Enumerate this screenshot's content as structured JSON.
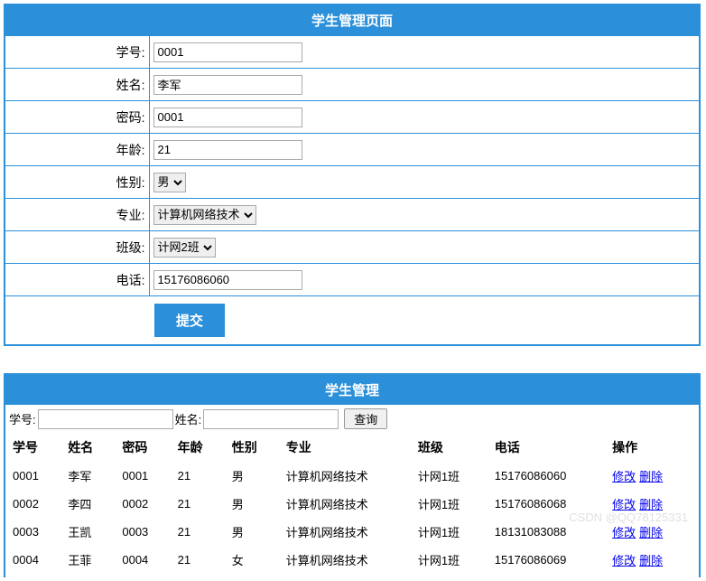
{
  "form": {
    "title": "学生管理页面",
    "fields": {
      "id_label": "学号:",
      "id_value": "0001",
      "name_label": "姓名:",
      "name_value": "李军",
      "password_label": "密码:",
      "password_value": "0001",
      "age_label": "年龄:",
      "age_value": "21",
      "gender_label": "性别:",
      "gender_value": "男",
      "major_label": "专业:",
      "major_value": "计算机网络技术",
      "class_label": "班级:",
      "class_value": "计网2班",
      "phone_label": "电话:",
      "phone_value": "15176086060"
    },
    "submit_label": "提交"
  },
  "list": {
    "title": "学生管理",
    "search": {
      "id_label": "学号:",
      "name_label": "姓名:",
      "button_label": "查询"
    },
    "columns": {
      "id": "学号",
      "name": "姓名",
      "password": "密码",
      "age": "年龄",
      "gender": "性别",
      "major": "专业",
      "class": "班级",
      "phone": "电话",
      "action": "操作"
    },
    "rows": [
      {
        "id": "0001",
        "name": "李军",
        "password": "0001",
        "age": "21",
        "gender": "男",
        "major": "计算机网络技术",
        "class": "计网1班",
        "phone": "15176086060"
      },
      {
        "id": "0002",
        "name": "李四",
        "password": "0002",
        "age": "21",
        "gender": "男",
        "major": "计算机网络技术",
        "class": "计网1班",
        "phone": "15176086068"
      },
      {
        "id": "0003",
        "name": "王凯",
        "password": "0003",
        "age": "21",
        "gender": "男",
        "major": "计算机网络技术",
        "class": "计网1班",
        "phone": "18131083088"
      },
      {
        "id": "0004",
        "name": "王菲",
        "password": "0004",
        "age": "21",
        "gender": "女",
        "major": "计算机网络技术",
        "class": "计网1班",
        "phone": "15176086069"
      }
    ],
    "action_edit": "修改",
    "action_delete": "删除"
  },
  "watermark": "CSDN @QQ78125331"
}
